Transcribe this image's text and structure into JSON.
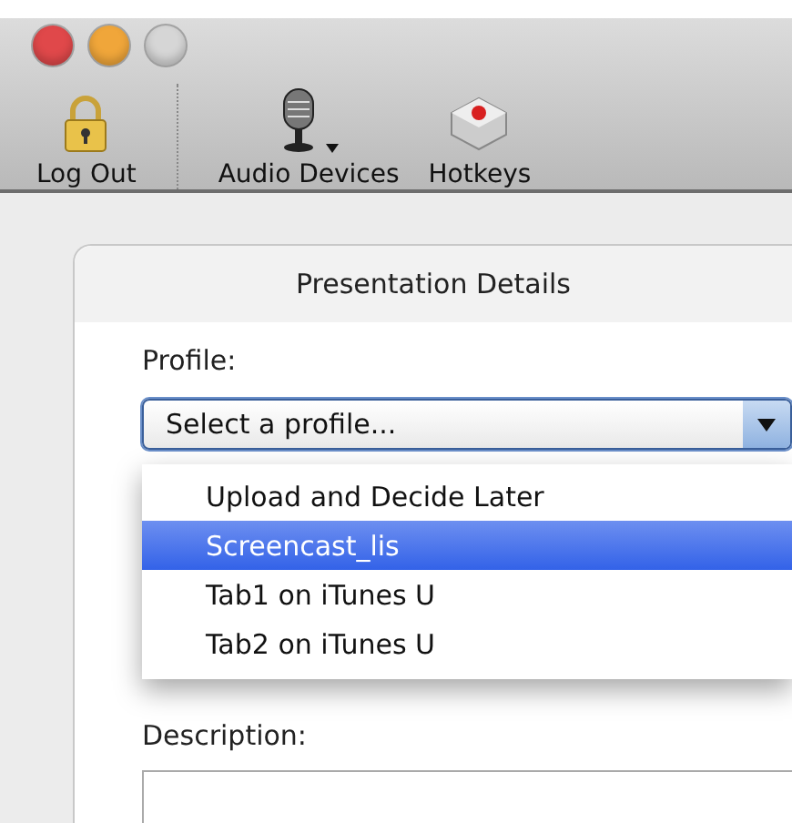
{
  "window": {
    "controls": [
      {
        "kind": "close",
        "disabled": false
      },
      {
        "kind": "minimize",
        "disabled": false
      },
      {
        "kind": "zoom",
        "disabled": true
      }
    ]
  },
  "toolbar": [
    {
      "kind": "lock",
      "label": "Log Out",
      "menu": false
    },
    {
      "kind": "microphone",
      "label": "Audio Devices",
      "menu": true
    },
    {
      "kind": "record",
      "label": "Hotkeys",
      "menu": false
    }
  ],
  "panel": {
    "title": "Presentation Details",
    "profile_label": "Profile:",
    "profile_select": {
      "value": "Select a profile...",
      "expanded": true,
      "options": [
        {
          "label": "Upload and Decide Later",
          "selected": false
        },
        {
          "label": "Screencast_lis",
          "selected": true
        },
        {
          "label": "Tab1 on iTunes U",
          "selected": false
        },
        {
          "label": "Tab2 on iTunes U",
          "selected": false
        }
      ]
    },
    "description_label": "Description:"
  }
}
